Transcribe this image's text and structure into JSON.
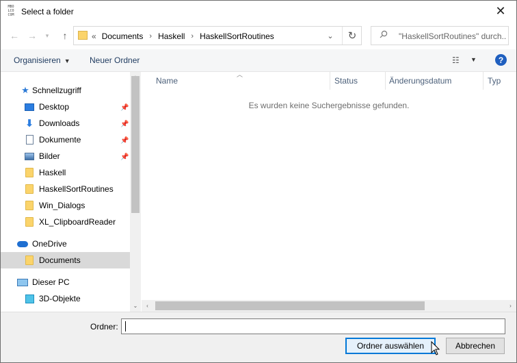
{
  "window": {
    "title": "Select a folder",
    "app_icon_text": "MBO\nLCO\nCOM",
    "close_glyph": "✕"
  },
  "navigation": {
    "back_icon": "arrow-left-icon",
    "forward_icon": "arrow-right-icon",
    "recent_icon": "chevron-down-icon",
    "up_icon": "arrow-up-icon"
  },
  "address_bar": {
    "overflow": "«",
    "crumbs": [
      "Documents",
      "Haskell",
      "HaskellSortRoutines"
    ],
    "separator": "›",
    "refresh_glyph": "↻"
  },
  "search": {
    "placeholder": "\"HaskellSortRoutines\" durch...",
    "icon": "search-icon"
  },
  "command_bar": {
    "organize_label": "Organisieren",
    "new_folder_label": "Neuer Ordner",
    "view_glyph": "☷",
    "help_label": "?"
  },
  "nav_pane": {
    "quick_access": {
      "label": "Schnellzugriff",
      "icon": "star-icon"
    },
    "items": [
      {
        "label": "Desktop",
        "icon": "desktop-icon",
        "pinned": true
      },
      {
        "label": "Downloads",
        "icon": "download-arrow-icon",
        "pinned": true
      },
      {
        "label": "Dokumente",
        "icon": "document-icon",
        "pinned": true
      },
      {
        "label": "Bilder",
        "icon": "pictures-icon",
        "pinned": true
      },
      {
        "label": "Haskell",
        "icon": "folder-icon",
        "pinned": false
      },
      {
        "label": "HaskellSortRoutines",
        "icon": "folder-icon",
        "pinned": false
      },
      {
        "label": "Win_Dialogs",
        "icon": "folder-icon",
        "pinned": false
      },
      {
        "label": "XL_ClipboardReader",
        "icon": "folder-icon",
        "pinned": false
      }
    ],
    "onedrive": {
      "label": "OneDrive",
      "icon": "cloud-icon"
    },
    "onedrive_items": [
      {
        "label": "Documents",
        "icon": "folder-icon",
        "selected": true
      }
    ],
    "this_pc": {
      "label": "Dieser PC",
      "icon": "computer-icon"
    },
    "this_pc_items": [
      {
        "label": "3D-Objekte",
        "icon": "cube-3d-icon"
      }
    ]
  },
  "content": {
    "columns": [
      "Name",
      "Status",
      "Änderungsdatum",
      "Typ"
    ],
    "empty_message": "Es wurden keine Suchergebnisse gefunden."
  },
  "footer": {
    "folder_label": "Ordner:",
    "folder_value": "",
    "select_button": "Ordner auswählen",
    "cancel_button": "Abbrechen"
  },
  "colors": {
    "accent": "#0078d7",
    "selection": "#d9d9d9",
    "folder": "#fbd46b",
    "help": "#1f5fbf"
  }
}
